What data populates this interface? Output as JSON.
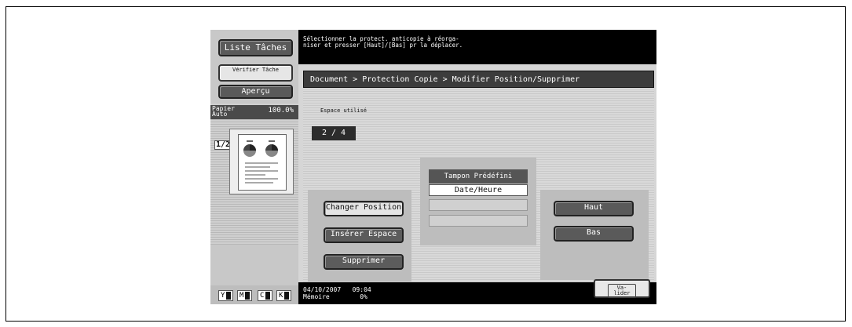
{
  "left": {
    "job_list_label": "Liste Tâches",
    "check_job_label": "Vérifier Tâche",
    "preview_label": "Aperçu",
    "paper_label": "Papier Auto",
    "zoom": "100.0%",
    "page_indicator": "1/2",
    "toner": [
      {
        "label": "Y",
        "fill": 0.6
      },
      {
        "label": "M",
        "fill": 0.6
      },
      {
        "label": "C",
        "fill": 0.6
      },
      {
        "label": "K",
        "fill": 0.6
      }
    ]
  },
  "message": "Sélectionner la protect. anticopie à réorga-\nniser et presser [Haut]/[Bas] pr la déplacer.",
  "breadcrumb": "Document  >  Protection Copie  >  Modifier Position/Supprimer",
  "space": {
    "label": "Espace utilisé",
    "value": "2 / 4"
  },
  "actions": {
    "change_position": "Changer Position",
    "insert_space": "Insérer Espace",
    "delete": "Supprimer",
    "up": "Haut",
    "down": "Bas"
  },
  "stamp": {
    "header": "Tampon Prédéfini",
    "selected": "Date/Heure"
  },
  "status": {
    "datetime": "04/10/2007   09:04",
    "memory": "Mémoire        0%"
  },
  "ok_label": "Va-\nlider"
}
